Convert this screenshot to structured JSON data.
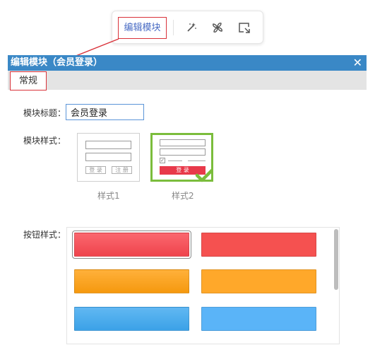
{
  "toolbar": {
    "edit_label": "编辑模块",
    "icons": [
      "magic-wand-icon",
      "pinwheel-icon",
      "resize-icon"
    ]
  },
  "dialog": {
    "title": "编辑模块（会员登录）",
    "close": "✕",
    "tab_general": "常规",
    "module_title_label": "模块标题：",
    "module_title_value": "会员登录",
    "module_style_label": "模块样式：",
    "style_options": [
      {
        "caption": "样式1",
        "login": "登 录",
        "register": "注 册"
      },
      {
        "caption": "样式2",
        "login": "登 录"
      }
    ],
    "selected_style": "样式2",
    "button_style_label": "按钮样式：",
    "button_colors": [
      {
        "name": "red",
        "color": "#f9464f",
        "selected": true
      },
      {
        "name": "red-flat",
        "color": "#f55150",
        "selected": false
      },
      {
        "name": "orange",
        "color": "#ff9f0f",
        "selected": false
      },
      {
        "name": "orange-flat",
        "color": "#ffa82a",
        "selected": false
      },
      {
        "name": "blue",
        "color": "#3ea8f0",
        "selected": false
      },
      {
        "name": "blue-flat",
        "color": "#5ab4f8",
        "selected": false
      }
    ]
  },
  "colors": {
    "header_bg": "#3a88c6",
    "highlight_border": "#d9323a",
    "selected_style_border": "#7bbd3c"
  }
}
